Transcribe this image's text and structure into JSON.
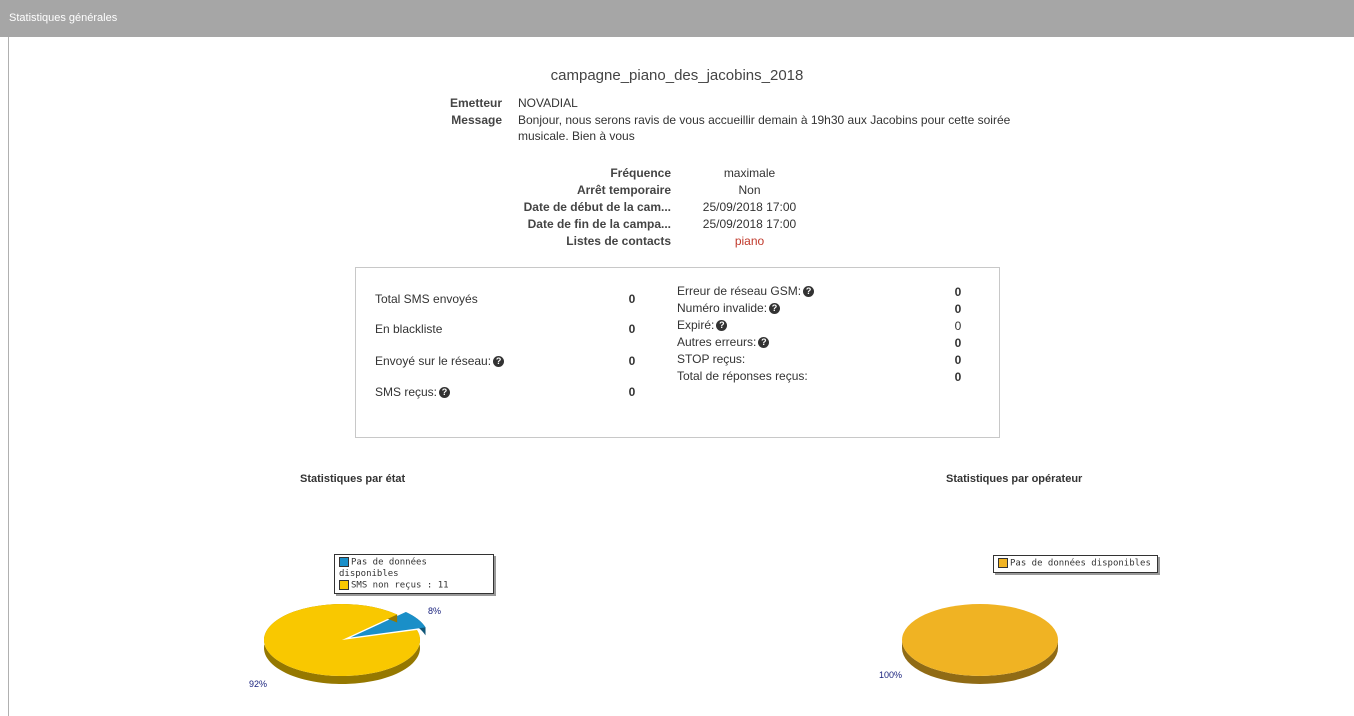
{
  "header": {
    "title": "Statistiques générales"
  },
  "campaign": {
    "name": "campagne_piano_des_jacobins_2018",
    "sender_label": "Emetteur",
    "sender": "NOVADIAL",
    "message_label": "Message",
    "message_line1": "Bonjour, nous serons ravis de vous accueillir demain à 19h30 aux Jacobins pour cette soirée",
    "message_line2": "musicale. Bien à vous"
  },
  "details": [
    {
      "label": "Fréquence",
      "value": "maximale"
    },
    {
      "label": "Arrêt temporaire",
      "value": "Non"
    },
    {
      "label": "Date de début de la cam...",
      "value": "25/09/2018 17:00"
    },
    {
      "label": "Date de fin de la campa...",
      "value": "25/09/2018 17:00"
    },
    {
      "label": "Listes de contacts",
      "value": "piano"
    }
  ],
  "stats_left": [
    {
      "label": "Total SMS envoyés",
      "value": "0"
    },
    {
      "label": "En blackliste",
      "value": "0"
    },
    {
      "label": "Envoyé sur le réseau:",
      "value": "0"
    },
    {
      "label": "SMS reçus:",
      "value": "0"
    }
  ],
  "stats_right": [
    {
      "label": "Erreur de réseau GSM:",
      "value": "0"
    },
    {
      "label": "Numéro invalide:",
      "value": "0"
    },
    {
      "label": "Expiré:",
      "value": "0"
    },
    {
      "label": "Autres erreurs:",
      "value": "0"
    },
    {
      "label": "STOP reçus:",
      "value": "0"
    },
    {
      "label": "Total de réponses reçus:",
      "value": "0"
    }
  ],
  "chart_data": [
    {
      "type": "pie",
      "title": "Statistiques par état",
      "categories": [
        "Pas de données disponibles",
        "SMS non reçus : 11"
      ],
      "values": [
        8,
        92
      ],
      "labels": [
        "8%",
        "92%"
      ],
      "colors": [
        "#1a8fc8",
        "#f9c800"
      ]
    },
    {
      "type": "pie",
      "title": "Statistiques par opérateur",
      "categories": [
        "Pas de données disponibles"
      ],
      "values": [
        100
      ],
      "labels": [
        "100%"
      ],
      "colors": [
        "#f0b323"
      ]
    }
  ]
}
